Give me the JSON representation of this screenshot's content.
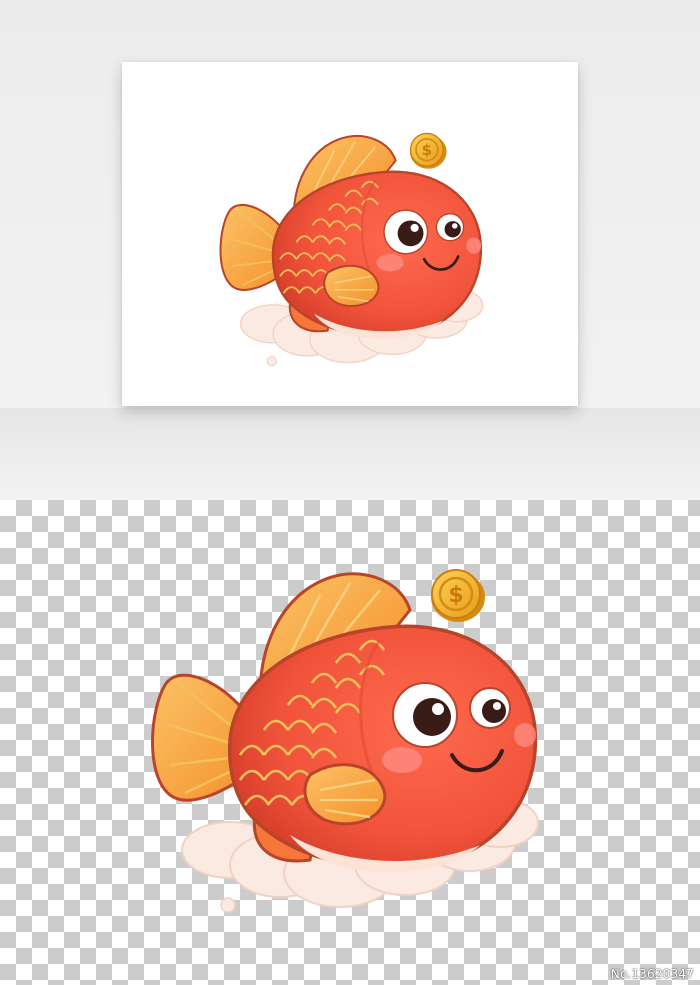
{
  "preview": {
    "subject": "cartoon-lucky-goldfish",
    "coin_symbol": "$",
    "colors": {
      "body": "#f0533a",
      "body_shade": "#d8402c",
      "fin": "#f7a23a",
      "fin_light": "#fbc365",
      "scale_line": "#f2c25a",
      "outline": "#b8442a",
      "cheek": "#ff8d86",
      "cloud": "#fbeae2",
      "cloud_shade": "#f0d2c4",
      "coin": "#f6b42b",
      "coin_rim": "#d58c12"
    }
  },
  "watermark": {
    "id_label": "No.13620347"
  }
}
